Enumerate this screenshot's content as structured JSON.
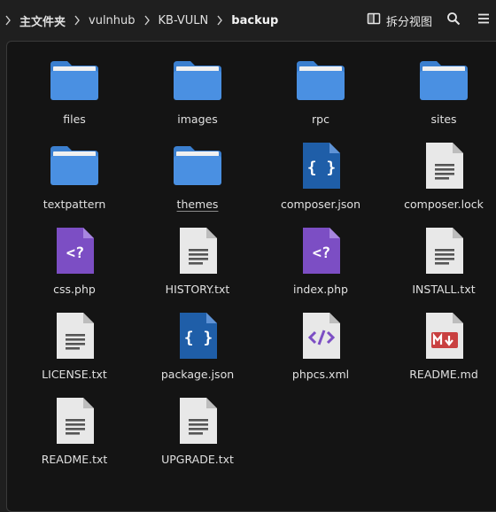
{
  "breadcrumbs": [
    "主文件夹",
    "vulnhub",
    "KB-VULN",
    "backup"
  ],
  "toolbar": {
    "split_view_label": "拆分视图",
    "split_view_icon": "split-view-icon",
    "search_icon": "search-icon",
    "menu_icon": "hamburger-menu-icon"
  },
  "colors": {
    "folder": "#4a90e2",
    "json": "#1f5ea8",
    "php": "#7c4ec4",
    "text": "#e8e8e8",
    "markdown": "#c94040"
  },
  "files": [
    {
      "name": "files",
      "kind": "folder"
    },
    {
      "name": "images",
      "kind": "folder"
    },
    {
      "name": "rpc",
      "kind": "folder"
    },
    {
      "name": "sites",
      "kind": "folder"
    },
    {
      "name": "textpattern",
      "kind": "folder"
    },
    {
      "name": "themes",
      "kind": "folder"
    },
    {
      "name": "composer.json",
      "kind": "json"
    },
    {
      "name": "composer.lock",
      "kind": "text"
    },
    {
      "name": "css.php",
      "kind": "php"
    },
    {
      "name": "HISTORY.txt",
      "kind": "text"
    },
    {
      "name": "index.php",
      "kind": "php"
    },
    {
      "name": "INSTALL.txt",
      "kind": "text"
    },
    {
      "name": "LICENSE.txt",
      "kind": "text"
    },
    {
      "name": "package.json",
      "kind": "json"
    },
    {
      "name": "phpcs.xml",
      "kind": "xml"
    },
    {
      "name": "README.md",
      "kind": "markdown"
    },
    {
      "name": "README.txt",
      "kind": "text"
    },
    {
      "name": "UPGRADE.txt",
      "kind": "text"
    }
  ]
}
